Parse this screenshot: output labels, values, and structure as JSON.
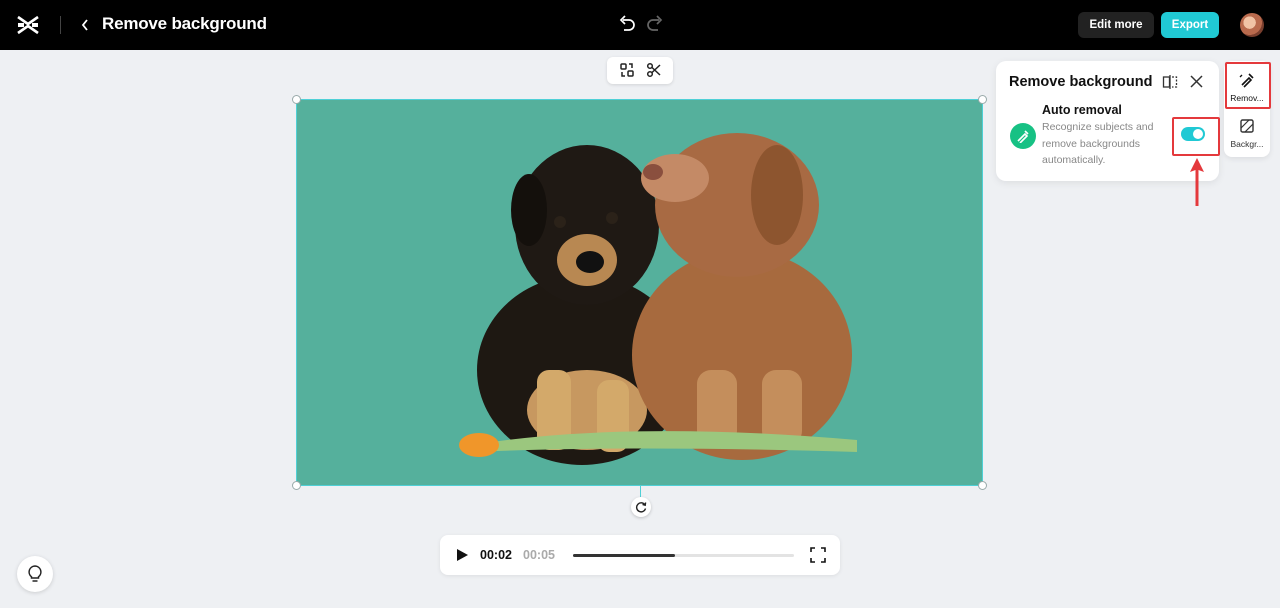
{
  "header": {
    "title": "Remove background",
    "edit_more_label": "Edit more",
    "export_label": "Export",
    "accent_color": "#20c9d4"
  },
  "player": {
    "current_time": "00:02",
    "total_time": "00:05",
    "progress": 0.46
  },
  "panel": {
    "title": "Remove background",
    "auto_removal": {
      "title": "Auto removal",
      "description": "Recognize subjects and remove backgrounds automatically.",
      "enabled": true
    }
  },
  "rail": {
    "items": [
      {
        "label": "Remov...",
        "icon": "remove-background-icon",
        "active": true
      },
      {
        "label": "Backgr...",
        "icon": "background-icon",
        "active": false
      }
    ]
  },
  "canvas": {
    "background_color": "#55b09c",
    "subject": "two puppies"
  }
}
